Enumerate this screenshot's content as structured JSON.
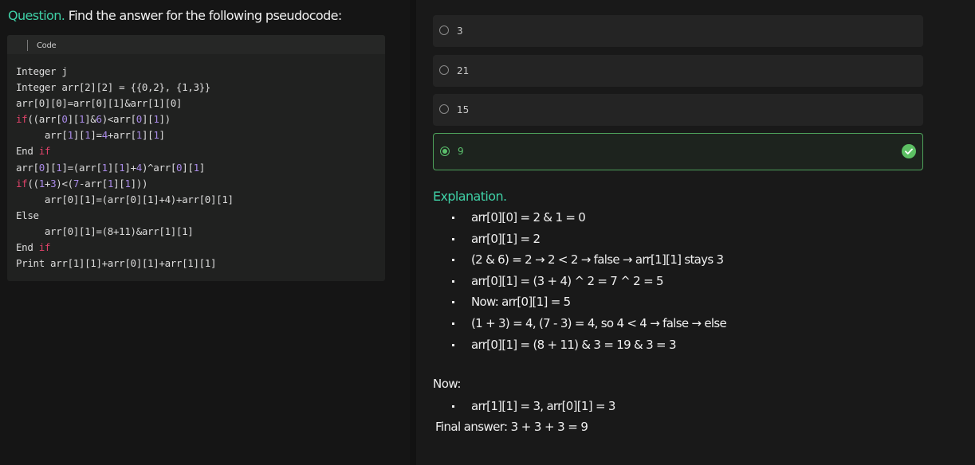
{
  "question": {
    "label": "Question.",
    "text": "Find the answer for the following pseudocode:"
  },
  "code": {
    "header_label": "Code",
    "lines": [
      "Integer j",
      "Integer arr[2][2] = {{0,2}, {1,3}}",
      "arr[0][0]=arr[0][1]&arr[1][0]",
      "if((arr[0][1]&6)<arr[0][1])",
      "     arr[1][1]=4+arr[1][1]",
      "End if",
      "arr[0][1]=(arr[1][1]+4)^arr[0][1]",
      "if((1+3)<(7-arr[1][1]))",
      "     arr[0][1]=(arr[0][1]+4)+arr[0][1]",
      "Else",
      "     arr[0][1]=(8+11)&arr[1][1]",
      "End if",
      "Print arr[1][1]+arr[0][1]+arr[1][1]"
    ]
  },
  "options": [
    {
      "label": "3",
      "selected": false,
      "correct": false
    },
    {
      "label": "21",
      "selected": false,
      "correct": false
    },
    {
      "label": "15",
      "selected": false,
      "correct": false
    },
    {
      "label": "9",
      "selected": true,
      "correct": true
    }
  ],
  "explanation": {
    "title": "Explanation.",
    "steps": [
      "arr[0][0] = 2 & 1 = 0",
      "arr[0][1] = 2",
      "(2 & 6) = 2 → 2 < 2 → false → arr[1][1] stays 3",
      "arr[0][1] = (3 + 4) ^ 2 = 7 ^ 2 = 5",
      "Now: arr[0][1] = 5",
      "(1 + 3) = 4, (7 - 3) = 4, so 4 < 4 → false → else",
      "arr[0][1] = (8 + 11) & 3 = 19 & 3 = 3"
    ],
    "now_label": "Now:",
    "now_steps": [
      "arr[1][1] = 3, arr[0][1] = 3"
    ],
    "final_answer": "Final answer: 3 + 3 + 3 = 9"
  },
  "colors": {
    "accent": "#3fd0a6",
    "correct": "#5bc06c",
    "keyword": "#e0436a",
    "number": "#a88ae6"
  },
  "icons": [
    "radio-icon",
    "check-circle-icon"
  ]
}
